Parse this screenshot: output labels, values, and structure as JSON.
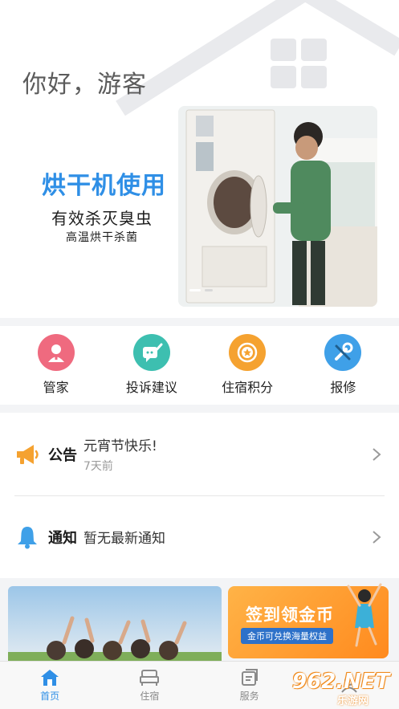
{
  "greeting": "你好，游客",
  "banner": {
    "title": "烘干机使用",
    "subtitle": "有效杀灭臭虫",
    "caption": "高温烘干杀菌"
  },
  "quick_menu": [
    {
      "label": "管家",
      "icon": "butler-icon",
      "color": "#ef6a7f"
    },
    {
      "label": "投诉建议",
      "icon": "feedback-icon",
      "color": "#3dbfb0"
    },
    {
      "label": "住宿积分",
      "icon": "points-icon",
      "color": "#f5a230"
    },
    {
      "label": "报修",
      "icon": "repair-icon",
      "color": "#3fa0e8"
    }
  ],
  "notices": {
    "announcement": {
      "heading": "公告",
      "text": "元宵节快乐!",
      "time": "7天前",
      "icon": "megaphone-icon"
    },
    "notification": {
      "heading": "通知",
      "text": "暂无最新通知",
      "icon": "bell-icon"
    }
  },
  "promo": {
    "title": "签到领金币",
    "subtitle": "金币可兑换海量权益"
  },
  "tabs": [
    {
      "label": "首页",
      "icon": "home-icon",
      "active": true
    },
    {
      "label": "住宿",
      "icon": "bed-icon",
      "active": false
    },
    {
      "label": "服务",
      "icon": "service-icon",
      "active": false
    },
    {
      "label": "",
      "icon": "profile-icon",
      "active": false
    }
  ],
  "watermark": {
    "text": "962.NET",
    "sub": "乐游网"
  },
  "colors": {
    "accent": "#2f8fe6",
    "promo": "#ff9a2e"
  }
}
